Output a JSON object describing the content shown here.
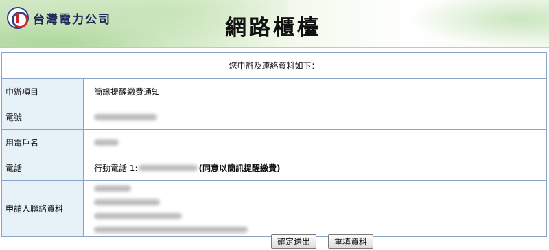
{
  "header": {
    "brand_name": "台灣電力公司",
    "page_title": "網路櫃檯"
  },
  "table": {
    "caption": "您申辦及連絡資料如下：",
    "rows": [
      {
        "label": "申辦項目",
        "value": "簡訊提醒繳費通知"
      },
      {
        "label": "電號",
        "value": ""
      },
      {
        "label": "用電戶名",
        "value": ""
      },
      {
        "label": "電話",
        "prefix": "行動電話 1:",
        "suffix": "(同意以簡訊提醒繳費)"
      },
      {
        "label": "申請人聯絡資料",
        "value": ""
      }
    ]
  },
  "buttons": {
    "submit_label": "確定送出",
    "reset_label": "重填資料"
  },
  "colors": {
    "label_bg": "#e6f2f8",
    "border": "#8aa3c8",
    "banner_green": "#cfe6c2"
  }
}
